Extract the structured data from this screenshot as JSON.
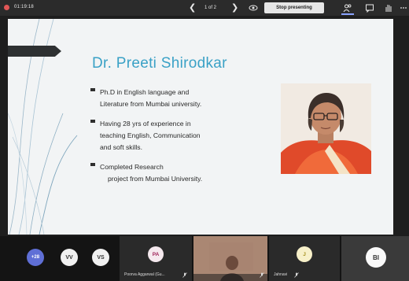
{
  "topbar": {
    "timer": "01:19:18",
    "page_indicator": "1 of 2",
    "stop_presenting_label": "Stop presenting",
    "icons": [
      "record-indicator",
      "chevron-left-icon",
      "chevron-right-icon",
      "eye-icon",
      "people-icon",
      "chat-icon",
      "raise-hand-icon",
      "more-icon"
    ]
  },
  "slide": {
    "title": "Dr. Preeti Shirodkar",
    "bullets": [
      {
        "lines": [
          "Ph.D in English language and",
          "Literature from Mumbai university."
        ]
      },
      {
        "lines": [
          "Having 28 yrs of experience in",
          "teaching English, Communication",
          "and soft skills."
        ]
      },
      {
        "lines": [
          "Completed Research",
          "project from Mumbai University."
        ]
      }
    ],
    "colors": {
      "title": "#3aa1c6",
      "background": "#f2f4f5",
      "accent_tab": "#2e3132"
    }
  },
  "participants": {
    "overflow_count": "+28",
    "tiles": [
      {
        "initials": "VV"
      },
      {
        "initials": "VS"
      },
      {
        "initials": "PA",
        "name": "Poorva Aggarwal (Gu..."
      },
      {
        "name": ""
      },
      {
        "initials": "J",
        "name": "Jahnavi"
      },
      {
        "initials": "BI"
      }
    ],
    "colors": {
      "overflow": "#5f6fd6",
      "pa_avatar": "#a0245a",
      "j_avatar": "#c7b43a"
    }
  }
}
